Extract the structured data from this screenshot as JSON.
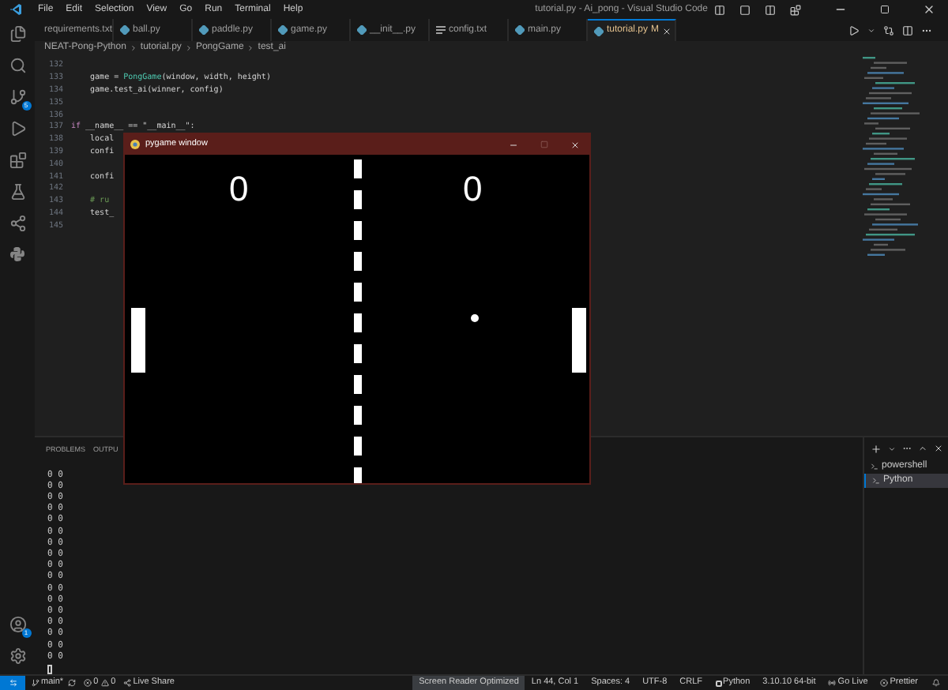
{
  "window": {
    "title": "tutorial.py - Ai_pong - Visual Studio Code"
  },
  "menu": [
    "File",
    "Edit",
    "Selection",
    "View",
    "Go",
    "Run",
    "Terminal",
    "Help"
  ],
  "tabs": [
    {
      "label": "requirements.txt",
      "kind": "text",
      "selected": false,
      "modified": false
    },
    {
      "label": "ball.py",
      "kind": "python",
      "selected": false,
      "modified": false
    },
    {
      "label": "paddle.py",
      "kind": "python",
      "selected": false,
      "modified": false
    },
    {
      "label": "game.py",
      "kind": "python",
      "selected": false,
      "modified": false
    },
    {
      "label": "__init__.py",
      "kind": "python",
      "selected": false,
      "modified": false
    },
    {
      "label": "config.txt",
      "kind": "text",
      "selected": false,
      "modified": false
    },
    {
      "label": "main.py",
      "kind": "python",
      "selected": false,
      "modified": false
    },
    {
      "label": "tutorial.py",
      "kind": "python",
      "selected": true,
      "modified": true,
      "badge": "M"
    }
  ],
  "breadcrumb": [
    "NEAT-Pong-Python",
    "tutorial.py",
    "PongGame",
    "test_ai"
  ],
  "activity_badges": {
    "source_control": "5",
    "accounts": "1"
  },
  "code": [
    {
      "number": "132"
    },
    {
      "number": "133",
      "segments": [
        {
          "text": "    game = ",
          "kind": "plain"
        },
        {
          "text": "PongGame",
          "kind": "class"
        },
        {
          "text": "(window, width, height)",
          "kind": "plain"
        }
      ]
    },
    {
      "number": "134",
      "segments": [
        {
          "text": "    game.test_ai(winner, config)",
          "kind": "plain"
        }
      ]
    },
    {
      "number": "135"
    },
    {
      "number": "136"
    },
    {
      "number": "137",
      "segments": [
        {
          "text": "if",
          "kind": "keyword"
        },
        {
          "text": " __name__ == \"__main__\":",
          "kind": "plain"
        }
      ]
    },
    {
      "number": "138",
      "segments": [
        {
          "text": "    local",
          "kind": "plain"
        }
      ]
    },
    {
      "number": "139",
      "segments": [
        {
          "text": "    confi",
          "kind": "plain"
        }
      ]
    },
    {
      "number": "140"
    },
    {
      "number": "141",
      "segments": [
        {
          "text": "    confi",
          "kind": "plain"
        }
      ]
    },
    {
      "number": "142"
    },
    {
      "number": "143",
      "segments": [
        {
          "text": "    # ru",
          "kind": "comment"
        }
      ]
    },
    {
      "number": "144",
      "segments": [
        {
          "text": "    test_",
          "kind": "plain"
        }
      ]
    },
    {
      "number": "145"
    }
  ],
  "pygame_window": {
    "title": "pygame window",
    "scores": [
      "0",
      "0"
    ]
  },
  "panel": {
    "tabs": [
      {
        "label": "PROBLEMS",
        "selected": false
      },
      {
        "label": "OUTPU",
        "selected": false
      }
    ],
    "terminal_lines": [
      "0 0",
      "0 0",
      "0 0",
      "0 0",
      "0 0",
      "0 0",
      "0 0",
      "0 0",
      "0 0",
      "0 0",
      "0 0",
      "0 0",
      "0 0",
      "0 0",
      "0 0",
      "0 0",
      "0 0"
    ],
    "terminals": [
      {
        "label": "powershell",
        "selected": false
      },
      {
        "label": "Python",
        "selected": true
      }
    ]
  },
  "status_bar": {
    "branch": "main*",
    "errors": "0",
    "warnings": "0",
    "live_share": "Live Share",
    "right": [
      {
        "label": "Screen Reader Optimized",
        "kind": "highlight"
      },
      {
        "label": "Ln 44, Col 1",
        "kind": "plain"
      },
      {
        "label": "Spaces: 4",
        "kind": "plain"
      },
      {
        "label": "UTF-8",
        "kind": "plain"
      },
      {
        "label": "CRLF",
        "kind": "plain"
      },
      {
        "label": "Python",
        "kind": "language"
      },
      {
        "label": "3.10.10 64-bit",
        "kind": "plain"
      },
      {
        "label": "Go Live",
        "kind": "golive"
      },
      {
        "label": "Prettier",
        "kind": "prettier"
      }
    ]
  }
}
